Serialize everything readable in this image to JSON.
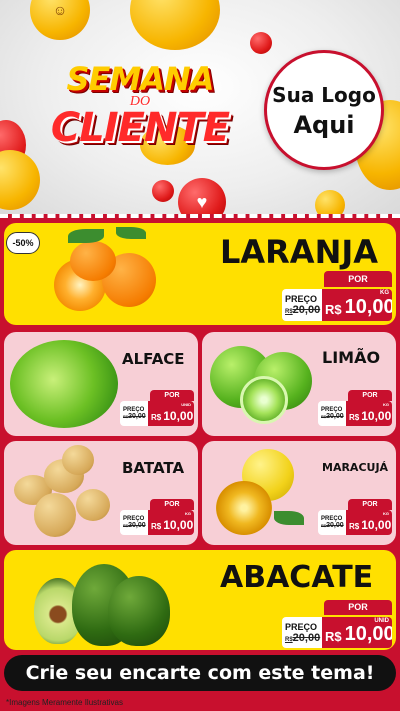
{
  "header": {
    "title_line1": "SEMANA",
    "title_line2": "DO",
    "title_line3": "CLIENTE",
    "logo_line1": "Sua Logo",
    "logo_line2": "Aqui"
  },
  "badge": "-50%",
  "products": {
    "laranja": {
      "name": "LARANJA",
      "por": "POR",
      "preco": "PREÇO",
      "old": "20,00",
      "old_prefix": "R$",
      "currency": "R$",
      "value": "10,00",
      "unit": "KG"
    },
    "alface": {
      "name": "ALFACE",
      "por": "POR",
      "preco": "PREÇO",
      "old": "20,00",
      "old_prefix": "R$",
      "currency": "R$",
      "value": "10,00",
      "unit": "UNID"
    },
    "limao": {
      "name": "LIMÃO",
      "por": "POR",
      "preco": "PREÇO",
      "old": "20,00",
      "old_prefix": "R$",
      "currency": "R$",
      "value": "10,00",
      "unit": "KG"
    },
    "batata": {
      "name": "BATATA",
      "por": "POR",
      "preco": "PREÇO",
      "old": "20,00",
      "old_prefix": "R$",
      "currency": "R$",
      "value": "10,00",
      "unit": "KG"
    },
    "maracuja": {
      "name": "MARACUJÁ",
      "por": "POR",
      "preco": "PREÇO",
      "old": "20,00",
      "old_prefix": "R$",
      "currency": "R$",
      "value": "10,00",
      "unit": "KG"
    },
    "abacate": {
      "name": "ABACATE",
      "por": "POR",
      "preco": "PREÇO",
      "old": "20,00",
      "old_prefix": "R$",
      "currency": "R$",
      "value": "10,00",
      "unit": "UNID"
    }
  },
  "cta": "Crie seu encarte com este tema!",
  "footnote": "*Imagens Meramente Ilustrativas",
  "colors": {
    "brand_red": "#c8102e",
    "accent_yellow": "#ffe000",
    "pink_card": "#f7cfd6"
  }
}
